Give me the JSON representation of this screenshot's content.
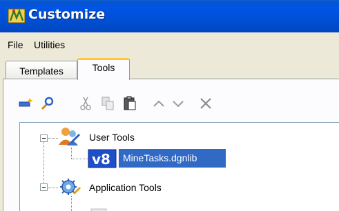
{
  "window": {
    "title": "Customize",
    "app_icon": "microstation-customize-icon",
    "titlebar_color": "#0055E5"
  },
  "menu": [
    "File",
    "Utilities"
  ],
  "tabs": [
    {
      "label": "Templates",
      "selected": false
    },
    {
      "label": "Tools",
      "selected": true
    }
  ],
  "toolbar": {
    "buttons": [
      {
        "icon": "new-toolbox-icon",
        "enabled": true
      },
      {
        "icon": "properties-wrench-icon",
        "enabled": true
      },
      {
        "icon": "cut-icon",
        "enabled": false
      },
      {
        "icon": "copy-icon",
        "enabled": false
      },
      {
        "icon": "paste-icon",
        "enabled": true
      },
      {
        "icon": "move-up-icon",
        "enabled": false
      },
      {
        "icon": "move-down-icon",
        "enabled": false
      },
      {
        "icon": "delete-icon",
        "enabled": false
      }
    ]
  },
  "tree": {
    "nodes": [
      {
        "label": "User Tools",
        "icon": "user-tools-icon",
        "expanded": true
      },
      {
        "label": "MineTasks.dgnlib",
        "icon": "v8-dgnlib-icon",
        "selected": true
      },
      {
        "label": "Application Tools",
        "icon": "application-tools-gear-icon",
        "expanded": true
      }
    ],
    "selection_color": "#316AC5"
  }
}
